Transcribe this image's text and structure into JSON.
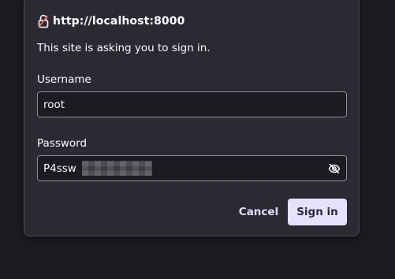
{
  "dialog": {
    "origin": "http://localhost:8000",
    "message": "This site is asking you to sign in.",
    "username": {
      "label": "Username",
      "value": "root"
    },
    "password": {
      "label": "Password",
      "visible_value": "P4ssw",
      "redacted": true
    },
    "buttons": {
      "cancel": "Cancel",
      "sign_in": "Sign in"
    },
    "icons": {
      "lock": "lock-icon",
      "reveal_password": "eye-slash-icon"
    },
    "colors": {
      "dialog_bg": "#2b2a33",
      "page_bg": "#1c1b22",
      "primary_button_bg": "#e8e0ff",
      "link_button_text": "#e6dcff",
      "warning_lock": "#ff5a5f"
    }
  }
}
